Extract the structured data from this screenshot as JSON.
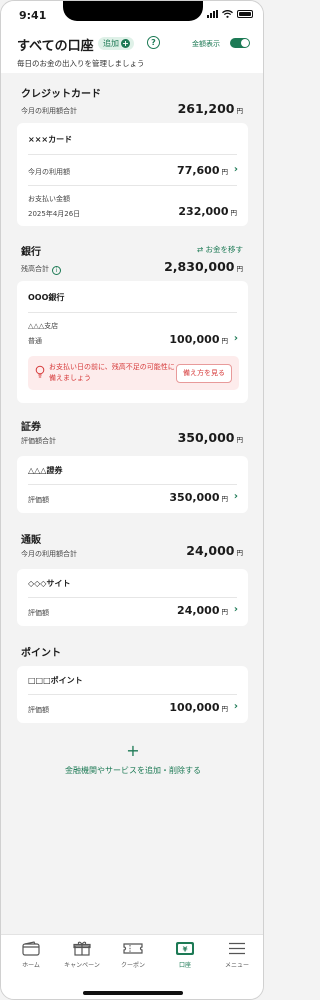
{
  "status": {
    "time": "9:41"
  },
  "header": {
    "title": "すべての口座",
    "add_label": "追加",
    "help_label": "?",
    "amount_toggle_label": "金額表示",
    "subtitle": "毎日のお金の出入りを管理しましょう"
  },
  "credit": {
    "title": "クレジットカード",
    "total_label": "今月の利用額合計",
    "total_value": "261,200",
    "currency": "円",
    "card": {
      "name": "×××カード",
      "usage_label": "今月の利用額",
      "usage_value": "77,600",
      "payment_label": "お支払い金額",
      "payment_date": "2025年4月26日",
      "payment_value": "232,000"
    }
  },
  "bank": {
    "title": "銀行",
    "transfer_label": "お金を移す",
    "total_label": "残高合計",
    "total_value": "2,830,000",
    "currency": "円",
    "card": {
      "name": "OOO銀行",
      "branch": "△△△支店",
      "account_type": "普通",
      "balance_value": "100,000",
      "alert_text": "お支払い日の前に、残高不足の可能性に備えましょう",
      "alert_button": "備え方を見る"
    }
  },
  "securities": {
    "title": "証券",
    "total_label": "評価額合計",
    "total_value": "350,000",
    "currency": "円",
    "card": {
      "name": "△△△證券",
      "row_label": "評価額",
      "row_value": "350,000"
    }
  },
  "shopping": {
    "title": "通販",
    "total_label": "今月の利用額合計",
    "total_value": "24,000",
    "currency": "円",
    "card": {
      "name": "◇◇◇サイト",
      "row_label": "評価額",
      "row_value": "24,000"
    }
  },
  "points": {
    "title": "ポイント",
    "card": {
      "name": "□□□ポイント",
      "row_label": "評価額",
      "row_value": "100,000"
    }
  },
  "add_more": {
    "plus": "+",
    "label": "金融機関やサービスを追加・削除する"
  },
  "tabbar": {
    "items": [
      {
        "label": "ホーム",
        "icon": "wallet-icon"
      },
      {
        "label": "キャンペーン",
        "icon": "gift-icon"
      },
      {
        "label": "クーポン",
        "icon": "ticket-icon"
      },
      {
        "label": "口座",
        "icon": "bank-account-icon",
        "active": true
      },
      {
        "label": "メニュー",
        "icon": "menu-icon"
      }
    ]
  },
  "colors": {
    "accent": "#1d7a55",
    "alert_text": "#d63a3a",
    "alert_bg": "#fdecec",
    "background": "#f3f3f3"
  }
}
